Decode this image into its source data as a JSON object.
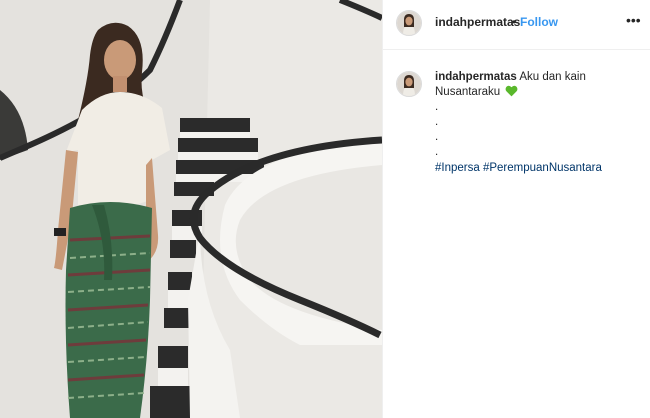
{
  "post": {
    "username": "indahpermatas",
    "separator": "•",
    "follow_label": "Follow",
    "more_label": "•••",
    "caption": {
      "username": "indahpermatas",
      "text_line1": "Aku dan kain",
      "text_line2": "Nusantaraku",
      "emoji": "green-heart-icon",
      "dots": [
        ".",
        ".",
        ".",
        "."
      ],
      "hashtags": [
        "#Inpersa",
        "#PerempuanNusantara"
      ]
    }
  },
  "colors": {
    "follow": "#3897f0",
    "hashtag": "#003569",
    "heart": "#5ab82c"
  }
}
